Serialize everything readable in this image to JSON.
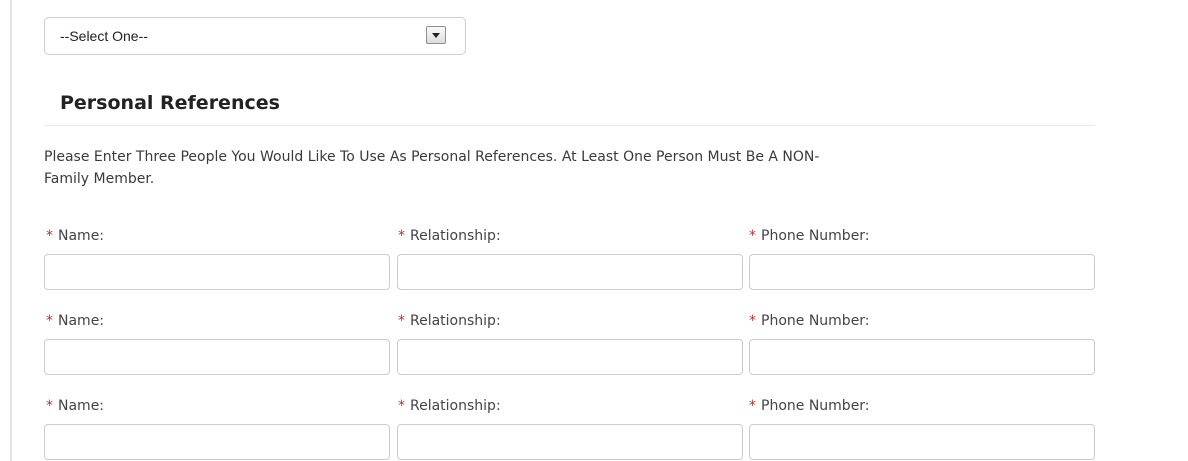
{
  "dropdown": {
    "selected": "--Select One--"
  },
  "section": {
    "title": "Personal References",
    "instructions_line1": "Please Enter Three People You Would Like To Use As Personal References. At Least One Person Must Be A NON-",
    "instructions_line2": "Family Member."
  },
  "labels": {
    "required_marker": "*",
    "name": "Name:",
    "relationship": "Relationship:",
    "phone": "Phone Number:"
  },
  "references": [
    {
      "name": "",
      "relationship": "",
      "phone": ""
    },
    {
      "name": "",
      "relationship": "",
      "phone": ""
    },
    {
      "name": "",
      "relationship": "",
      "phone": ""
    }
  ],
  "colors": {
    "required_marker": "#b4332e",
    "input_border": "#cccccc"
  }
}
